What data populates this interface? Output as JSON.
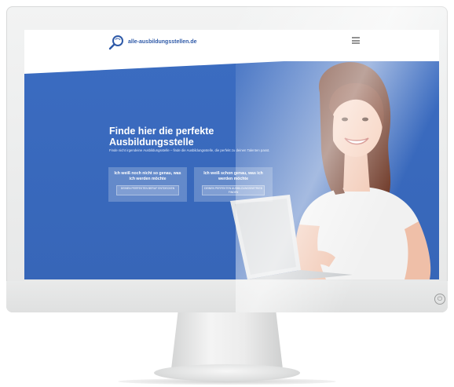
{
  "site": {
    "logo_text": "alle-ausbildungsstellen.de",
    "menu_icon": "hamburger-menu-icon"
  },
  "hero": {
    "title_line1": "Finde hier die perfekte",
    "title_line2": "Ausbildungsstelle",
    "subtitle": "Finde nicht irgendeine Ausbildungsstelle – finde die Ausbildungsstelle, die perfekt zu deinen Talenten passt."
  },
  "cards": [
    {
      "title": "Ich weiß noch nicht so genau, was ich werden möchte",
      "button": "DEINEN PERFEKTEN BERUF ENTDECKEN"
    },
    {
      "title": "Ich weiß schon genau, was ich werden möchte",
      "button": "DEINEN PERFEKTEN AUSBILDUNGSBETRIEB FINDEN"
    }
  ],
  "colors": {
    "hero_blue": "#3a6bc0",
    "brand": "#2f5aa8"
  },
  "device": {
    "power_icon": "power-icon"
  }
}
